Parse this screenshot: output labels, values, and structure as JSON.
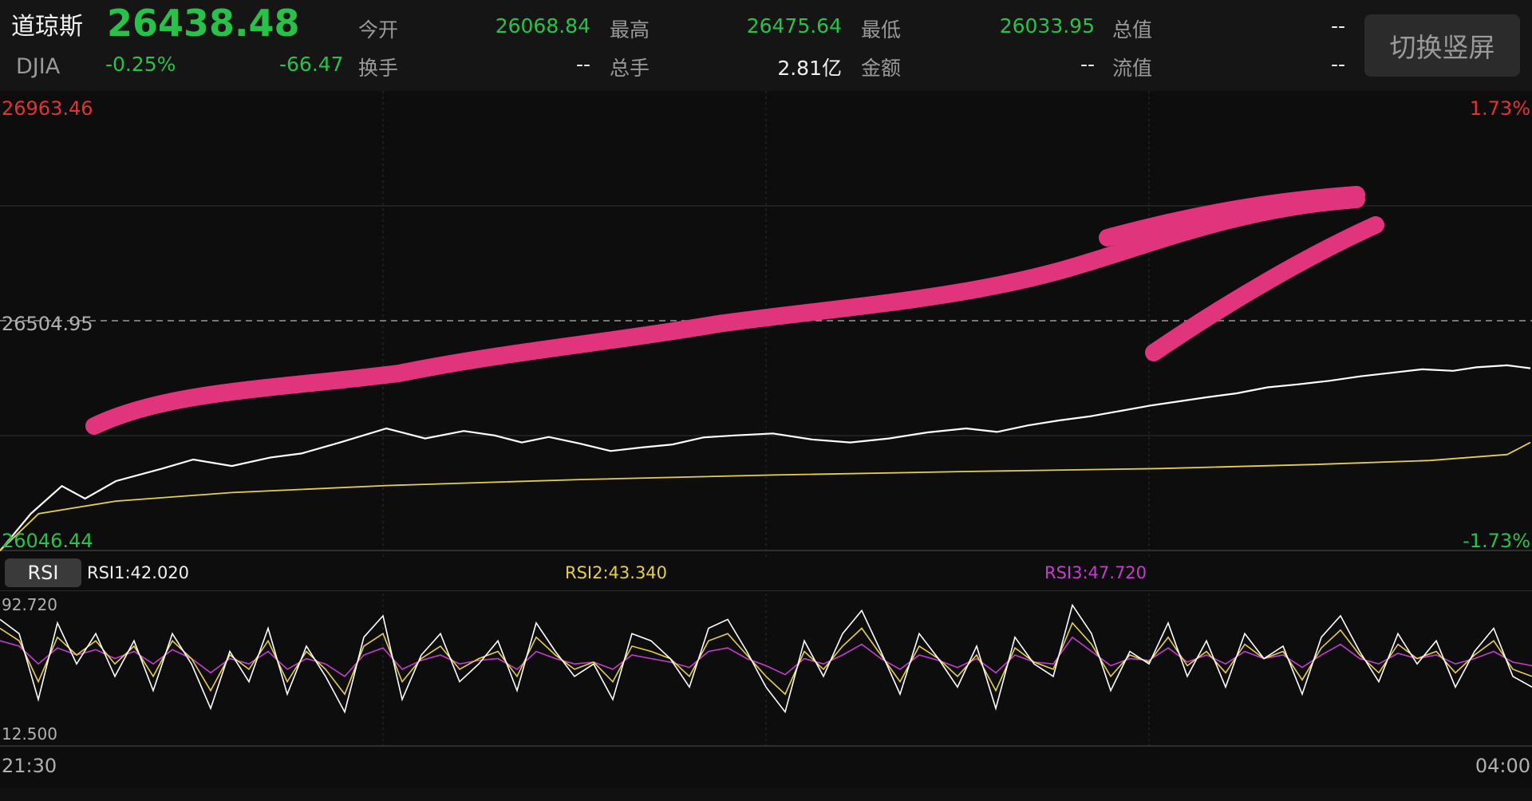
{
  "header": {
    "name": "道琼斯",
    "price": "26438.48",
    "code": "DJIA",
    "change_pct": "-0.25%",
    "change": "-66.47",
    "stats": [
      {
        "label": "今开",
        "value": "26068.84",
        "tone": "green"
      },
      {
        "label": "最高",
        "value": "26475.64",
        "tone": "green"
      },
      {
        "label": "最低",
        "value": "26033.95",
        "tone": "green"
      },
      {
        "label": "总值",
        "value": "--",
        "tone": "white"
      },
      {
        "label": "换手",
        "value": "--",
        "tone": "white"
      },
      {
        "label": "总手",
        "value": "2.81亿",
        "tone": "white"
      },
      {
        "label": "金额",
        "value": "--",
        "tone": "white"
      },
      {
        "label": "流值",
        "value": "--",
        "tone": "white"
      }
    ],
    "switch_button": "切换竖屏"
  },
  "colors": {
    "up": "#e8312f",
    "down": "#28c24a",
    "price_line": "#ffffff",
    "avg_line": "#e6cf4a",
    "rsi1": "#ffffff",
    "rsi2": "#e6cf4a",
    "rsi3": "#c73bd0",
    "annotation": "#e0357c"
  },
  "chart_data": [
    {
      "type": "line",
      "ylim": [
        26046.44,
        26963.46
      ],
      "reference_line": 26504.95,
      "y_labels": {
        "top": "26963.46",
        "middle": "26504.95",
        "bottom": "26046.44"
      },
      "pct_labels": {
        "top": "1.73%",
        "bottom": "-1.73%"
      },
      "x_labels": [
        "21:30",
        "04:00"
      ],
      "series": [
        {
          "role": "price",
          "points": [
            [
              0,
              26046
            ],
            [
              8,
              26120
            ],
            [
              16,
              26175
            ],
            [
              22,
              26150
            ],
            [
              30,
              26185
            ],
            [
              42,
              26210
            ],
            [
              50,
              26228
            ],
            [
              60,
              26215
            ],
            [
              70,
              26232
            ],
            [
              78,
              26240
            ],
            [
              88,
              26262
            ],
            [
              100,
              26290
            ],
            [
              110,
              26270
            ],
            [
              120,
              26285
            ],
            [
              128,
              26276
            ],
            [
              135,
              26262
            ],
            [
              142,
              26273
            ],
            [
              150,
              26260
            ],
            [
              158,
              26245
            ],
            [
              166,
              26252
            ],
            [
              174,
              26258
            ],
            [
              182,
              26272
            ],
            [
              190,
              26276
            ],
            [
              200,
              26280
            ],
            [
              210,
              26268
            ],
            [
              220,
              26262
            ],
            [
              230,
              26270
            ],
            [
              240,
              26282
            ],
            [
              250,
              26290
            ],
            [
              258,
              26283
            ],
            [
              266,
              26296
            ],
            [
              274,
              26306
            ],
            [
              282,
              26314
            ],
            [
              290,
              26325
            ],
            [
              298,
              26336
            ],
            [
              305,
              26344
            ],
            [
              312,
              26352
            ],
            [
              320,
              26360
            ],
            [
              328,
              26372
            ],
            [
              336,
              26378
            ],
            [
              344,
              26385
            ],
            [
              352,
              26394
            ],
            [
              360,
              26401
            ],
            [
              368,
              26408
            ],
            [
              376,
              26405
            ],
            [
              382,
              26412
            ],
            [
              390,
              26416
            ],
            [
              396,
              26410
            ]
          ]
        },
        {
          "role": "average",
          "points": [
            [
              0,
              26046
            ],
            [
              10,
              26120
            ],
            [
              30,
              26145
            ],
            [
              60,
              26162
            ],
            [
              100,
              26176
            ],
            [
              150,
              26188
            ],
            [
              200,
              26197
            ],
            [
              250,
              26204
            ],
            [
              300,
              26210
            ],
            [
              340,
              26218
            ],
            [
              370,
              26226
            ],
            [
              390,
              26238
            ],
            [
              396,
              26262
            ]
          ]
        }
      ]
    },
    {
      "type": "line",
      "title": "RSI",
      "ylim": [
        12.5,
        92.72
      ],
      "y_labels": {
        "top": "92.720",
        "bottom": "12.500"
      },
      "series": [
        {
          "name": "RSI1",
          "label": "RSI1:42.020",
          "values": [
            80,
            72,
            35,
            78,
            55,
            72,
            48,
            68,
            40,
            72,
            55,
            30,
            62,
            45,
            75,
            38,
            65,
            48,
            28,
            70,
            82,
            35,
            60,
            72,
            45,
            55,
            68,
            40,
            78,
            62,
            48,
            55,
            35,
            72,
            68,
            58,
            42,
            75,
            80,
            62,
            42,
            28,
            68,
            48,
            72,
            85,
            62,
            38,
            72,
            58,
            42,
            65,
            30,
            70,
            55,
            48,
            88,
            72,
            40,
            62,
            55,
            78,
            48,
            68,
            42,
            72,
            58,
            65,
            38,
            70,
            82,
            62,
            45,
            72,
            55,
            68,
            42,
            62,
            75,
            48,
            42
          ]
        },
        {
          "name": "RSI2",
          "label": "RSI2:43.340",
          "values": [
            75,
            68,
            45,
            70,
            60,
            68,
            55,
            65,
            48,
            68,
            58,
            40,
            60,
            52,
            68,
            45,
            62,
            52,
            38,
            65,
            72,
            45,
            58,
            65,
            52,
            58,
            62,
            48,
            70,
            60,
            52,
            56,
            45,
            65,
            62,
            58,
            48,
            68,
            72,
            60,
            48,
            38,
            62,
            52,
            65,
            75,
            60,
            45,
            65,
            58,
            48,
            60,
            40,
            64,
            56,
            52,
            78,
            66,
            48,
            60,
            56,
            70,
            54,
            62,
            50,
            66,
            58,
            62,
            46,
            64,
            74,
            60,
            50,
            66,
            58,
            62,
            50,
            60,
            68,
            52,
            48
          ]
        },
        {
          "name": "RSI3",
          "label": "RSI3:47.720",
          "values": [
            68,
            65,
            55,
            64,
            60,
            63,
            58,
            62,
            55,
            63,
            58,
            50,
            58,
            55,
            62,
            52,
            58,
            55,
            48,
            60,
            64,
            52,
            57,
            60,
            55,
            57,
            58,
            52,
            62,
            58,
            55,
            56,
            52,
            60,
            58,
            56,
            53,
            62,
            64,
            58,
            54,
            49,
            58,
            55,
            60,
            66,
            58,
            52,
            60,
            57,
            53,
            58,
            50,
            60,
            56,
            55,
            70,
            62,
            54,
            58,
            57,
            64,
            56,
            60,
            55,
            62,
            58,
            60,
            53,
            60,
            66,
            58,
            55,
            61,
            58,
            60,
            55,
            58,
            62,
            56,
            54
          ]
        }
      ]
    }
  ]
}
